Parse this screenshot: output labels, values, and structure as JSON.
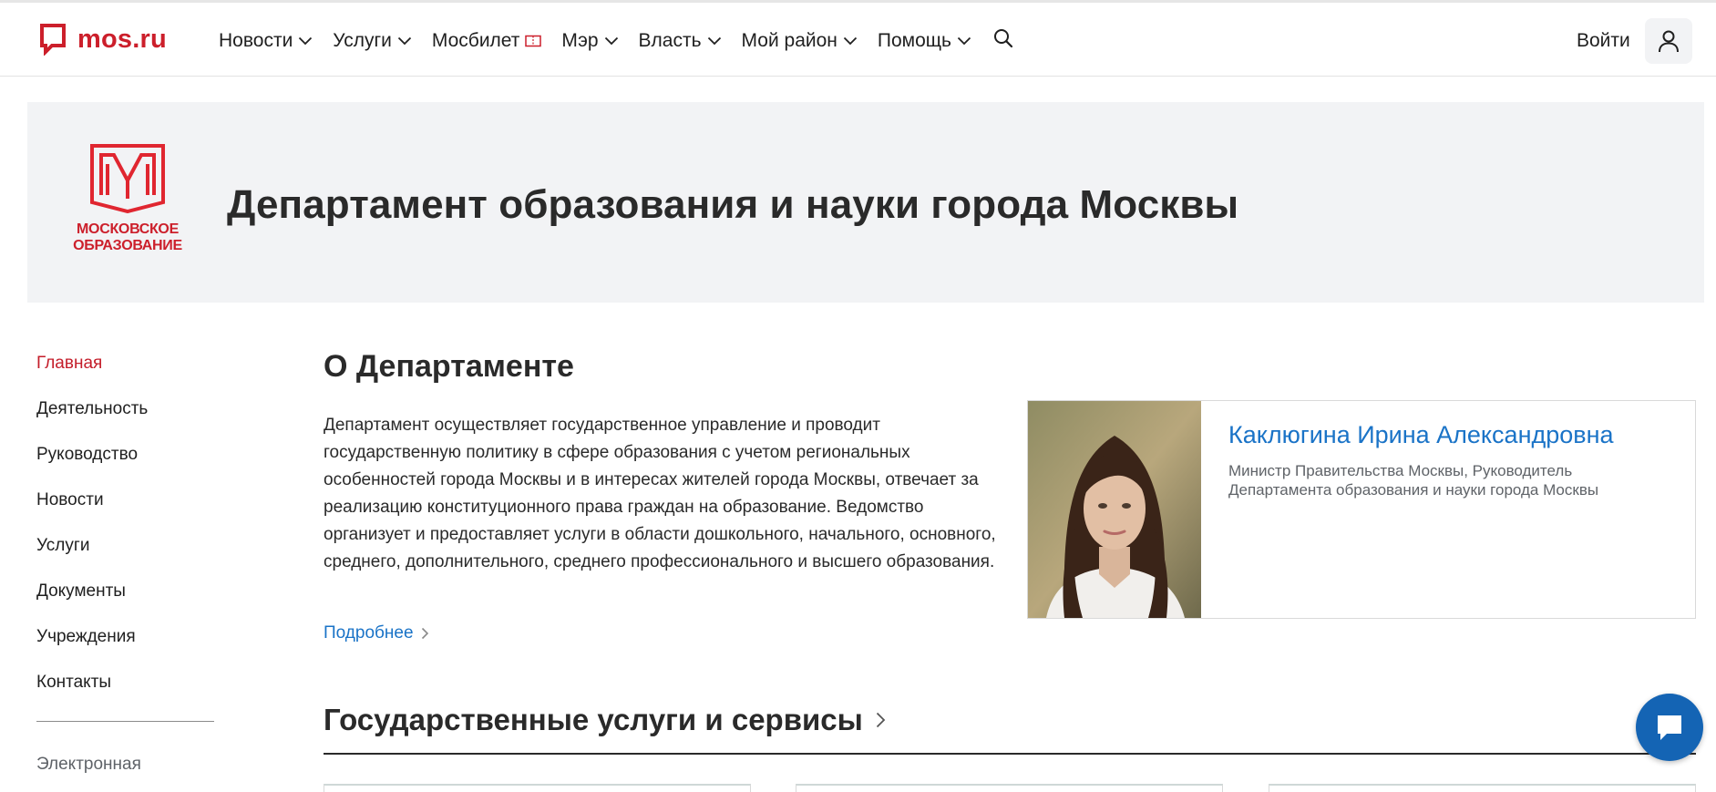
{
  "header": {
    "logo_text": "mos.ru",
    "nav": [
      {
        "label": "Новости",
        "has_dropdown": true
      },
      {
        "label": "Услуги",
        "has_dropdown": true
      },
      {
        "label": "Мосбилет",
        "has_dropdown": false,
        "icon": "ticket-icon"
      },
      {
        "label": "Мэр",
        "has_dropdown": true
      },
      {
        "label": "Власть",
        "has_dropdown": true
      },
      {
        "label": "Мой район",
        "has_dropdown": true
      },
      {
        "label": "Помощь",
        "has_dropdown": true
      }
    ],
    "search_icon": "search-icon",
    "login_label": "Войти",
    "user_icon": "user-icon"
  },
  "banner": {
    "logo_caption_line1": "МОСКОВСКОЕ",
    "logo_caption_line2": "ОБРАЗОВАНИЕ",
    "title": "Департамент образования и науки города Москвы"
  },
  "sidebar": {
    "items": [
      {
        "label": "Главная",
        "active": true
      },
      {
        "label": "Деятельность",
        "active": false
      },
      {
        "label": "Руководство",
        "active": false
      },
      {
        "label": "Новости",
        "active": false
      },
      {
        "label": "Услуги",
        "active": false
      },
      {
        "label": "Документы",
        "active": false
      },
      {
        "label": "Учреждения",
        "active": false
      },
      {
        "label": "Контакты",
        "active": false
      }
    ],
    "extra_label": "Электронная"
  },
  "about": {
    "title": "О Департаменте",
    "text": "Департамент осуществляет государственное управление и проводит государственную политику в сфере образования с учетом региональных особенностей города Москвы и в интересах жителей города Москвы, отвечает за реализацию конституционного права граждан на образование. Ведомство организует и предоставляет услуги в области дошкольного, начального, основного, среднего, дополнительного, среднего профессионального и высшего образования.",
    "more_label": "Подробнее"
  },
  "minister": {
    "name": "Каклюгина Ирина Александровна",
    "role": "Министр Правительства Москвы, Руководитель Департамента образования и науки города Москвы"
  },
  "services": {
    "title": "Государственные услуги и сервисы"
  },
  "colors": {
    "brand_red": "#cc1f2b",
    "link_blue": "#1a73c7",
    "chat_blue": "#1464b4",
    "banner_bg": "#f2f3f5"
  }
}
